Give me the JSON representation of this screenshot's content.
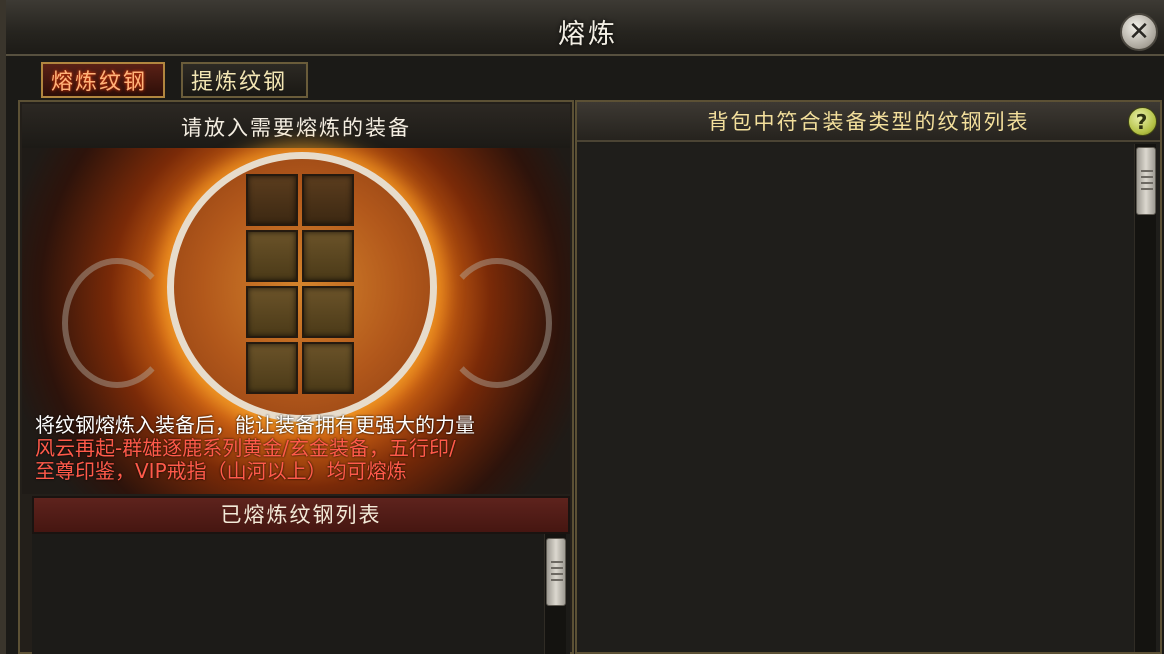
{
  "window": {
    "title": "熔炼",
    "close_icon": "close-icon"
  },
  "tabs": [
    {
      "label": "熔炼纹钢",
      "active": true
    },
    {
      "label": "提炼纹钢",
      "active": false
    }
  ],
  "left": {
    "header": "请放入需要熔炼的装备",
    "slot_count": 8,
    "desc_line1": "将纹钢熔炼入装备后，能让装备拥有更强大的力量",
    "desc_line2": "风云再起-群雄逐鹿系列黄金/玄金装备，五行印/",
    "desc_line3": "至尊印鉴，VIP戒指（山河以上）均可熔炼",
    "smelted_header": "已熔炼纹钢列表"
  },
  "right": {
    "header": "背包中符合装备类型的纹钢列表",
    "help_icon": "?"
  },
  "colors": {
    "accent_gold": "#f3df9c",
    "active_tab_text": "#ffb37a",
    "warning_red": "#ff5a4a"
  }
}
